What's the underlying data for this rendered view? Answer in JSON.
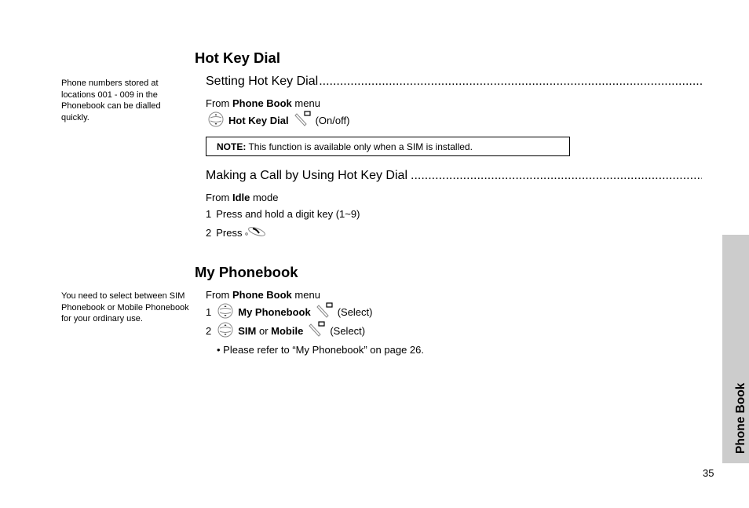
{
  "side_notes": [
    "Phone numbers stored at locations 001 - 009 in the Phonebook can be dialled quickly.",
    "You need to select between SIM Phonebook or Mobile Phonebook for your ordinary use."
  ],
  "hot_key_dial": {
    "title": "Hot Key Dial",
    "setting": {
      "heading": "Setting Hot Key Dial",
      "from_prefix": "From ",
      "from_bold": "Phone Book",
      "from_suffix": " menu",
      "step_bold": "Hot Key Dial",
      "step_suffix": "(On/off)",
      "icons": [
        "navigation-key-icon",
        "soft-key-icon"
      ]
    },
    "note": {
      "label": "NOTE:",
      "text": " This function is available only when a SIM is installed."
    },
    "making_call": {
      "heading": "Making a Call by Using Hot Key Dial",
      "from_prefix": "From ",
      "from_bold": "Idle",
      "from_suffix": " mode",
      "step1_num": "1",
      "step1_text": "Press and hold a digit key (1~9)",
      "step2_num": "2",
      "step2_text": "Press",
      "icons": [
        "send-key-icon"
      ]
    }
  },
  "my_phonebook": {
    "title": "My Phonebook",
    "from_prefix": "From ",
    "from_bold": "Phone Book",
    "from_suffix": " menu",
    "step1_num": "1",
    "step1_bold": "My Phonebook",
    "step1_suffix": "(Select)",
    "step2_num": "2",
    "step2_bold1": "SIM",
    "step2_or": " or ",
    "step2_bold2": "Mobile",
    "step2_suffix": "(Select)",
    "bullet": "• Please refer to “My Phonebook” on page 26."
  },
  "section_tab": {
    "label": "Phone Book",
    "color": "#cccccc"
  },
  "page_number": "35"
}
